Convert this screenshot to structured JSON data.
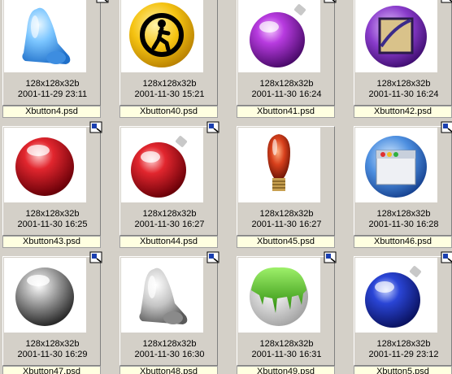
{
  "thumbnails": [
    {
      "dims": "128x128x32b",
      "date": "2001-11-29 23:11",
      "filename": "Xbutton4.psd",
      "icon": "blue-bell-icon",
      "color": "#4aa3f0"
    },
    {
      "dims": "128x128x32b",
      "date": "2001-11-30 15:21",
      "filename": "Xbutton40.psd",
      "icon": "pedestrian-sign-icon",
      "color": "#f2b60a"
    },
    {
      "dims": "128x128x32b",
      "date": "2001-11-30 16:24",
      "filename": "Xbutton41.psd",
      "icon": "purple-ornament-icon",
      "color": "#9b1fc7"
    },
    {
      "dims": "128x128x32b",
      "date": "2001-11-30 16:24",
      "filename": "Xbutton42.psd",
      "icon": "purple-picture-button-icon",
      "color": "#7a2fb3"
    },
    {
      "dims": "128x128x32b",
      "date": "2001-11-30 16:25",
      "filename": "Xbutton43.psd",
      "icon": "red-sphere-icon",
      "color": "#d0161f"
    },
    {
      "dims": "128x128x32b",
      "date": "2001-11-30 16:27",
      "filename": "Xbutton44.psd",
      "icon": "red-ornament-icon",
      "color": "#d0161f"
    },
    {
      "dims": "128x128x32b",
      "date": "2001-11-30 16:27",
      "filename": "Xbutton45.psd",
      "icon": "light-bulb-icon",
      "color": "#c8341a"
    },
    {
      "dims": "128x128x32b",
      "date": "2001-11-30 16:28",
      "filename": "Xbutton46.psd",
      "icon": "window-button-icon",
      "color": "#3b7fd6"
    },
    {
      "dims": "128x128x32b",
      "date": "2001-11-30 16:29",
      "filename": "Xbutton47.psd",
      "icon": "gray-sphere-icon",
      "color": "#9a9a9a"
    },
    {
      "dims": "128x128x32b",
      "date": "2001-11-30 16:30",
      "filename": "Xbutton48.psd",
      "icon": "silver-bell-icon",
      "color": "#b8b8b8"
    },
    {
      "dims": "128x128x32b",
      "date": "2001-11-30 16:31",
      "filename": "Xbutton49.psd",
      "icon": "green-slime-sphere-icon",
      "color": "#3fae1a"
    },
    {
      "dims": "128x128x32b",
      "date": "2001-11-29 23:12",
      "filename": "Xbutton5.psd",
      "icon": "blue-ornament-icon",
      "color": "#1a2fb0"
    }
  ]
}
